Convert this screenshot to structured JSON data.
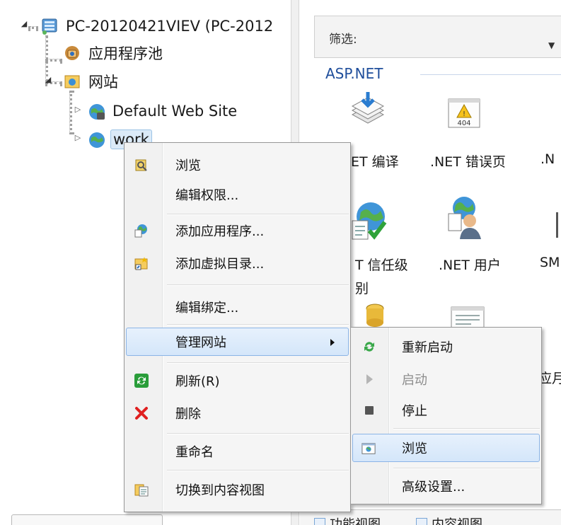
{
  "tree": {
    "server": "PC-20120421VIEV (PC-2012",
    "app_pools": "应用程序池",
    "sites": "网站",
    "default_site": "Default Web Site",
    "work_site": "work"
  },
  "features": {
    "filter_label": "筛选:",
    "group_title": "ASP.NET",
    "items": [
      {
        "label": "ET 编译",
        "icon": "compile-icon"
      },
      {
        "label": ".NET 错误页",
        "icon": "error-page-404-icon"
      },
      {
        "label": ".N",
        "icon": "partial-icon"
      },
      {
        "label": "T 信任级",
        "label2": "别",
        "icon": "trust-level-icon"
      },
      {
        "label": ".NET 用户",
        "icon": "users-icon"
      },
      {
        "label": "SM",
        "icon": "partial-icon"
      },
      {
        "label": "应月",
        "icon": "partial-icon"
      }
    ],
    "tabs": {
      "features_view": "功能视图",
      "content_view": "内容视图"
    }
  },
  "context_menu": {
    "items": [
      {
        "label": "浏览",
        "icon": "browse-icon"
      },
      {
        "label": "编辑权限..."
      },
      {
        "label": "添加应用程序...",
        "icon": "add-application-icon"
      },
      {
        "label": "添加虚拟目录...",
        "icon": "add-virtual-directory-icon"
      },
      {
        "label": "编辑绑定..."
      },
      {
        "label": "管理网站",
        "has_submenu": true
      },
      {
        "label": "刷新(R)",
        "icon": "refresh-icon"
      },
      {
        "label": "删除",
        "icon": "delete-icon"
      },
      {
        "label": "重命名"
      },
      {
        "label": "切换到内容视图",
        "icon": "content-view-icon"
      }
    ]
  },
  "submenu": {
    "items": [
      {
        "label": "重新启动",
        "icon": "restart-icon"
      },
      {
        "label": "启动",
        "icon": "start-icon",
        "disabled": true
      },
      {
        "label": "停止",
        "icon": "stop-icon"
      },
      {
        "label": "浏览",
        "icon": "browse-site-icon"
      },
      {
        "label": "高级设置..."
      }
    ]
  },
  "colors": {
    "highlight_bg": "#d4e6fa",
    "highlight_border": "#8bb4e6",
    "group_title": "#1f4e9b",
    "delete_red": "#e02020",
    "refresh_green": "#2a9d3a"
  }
}
